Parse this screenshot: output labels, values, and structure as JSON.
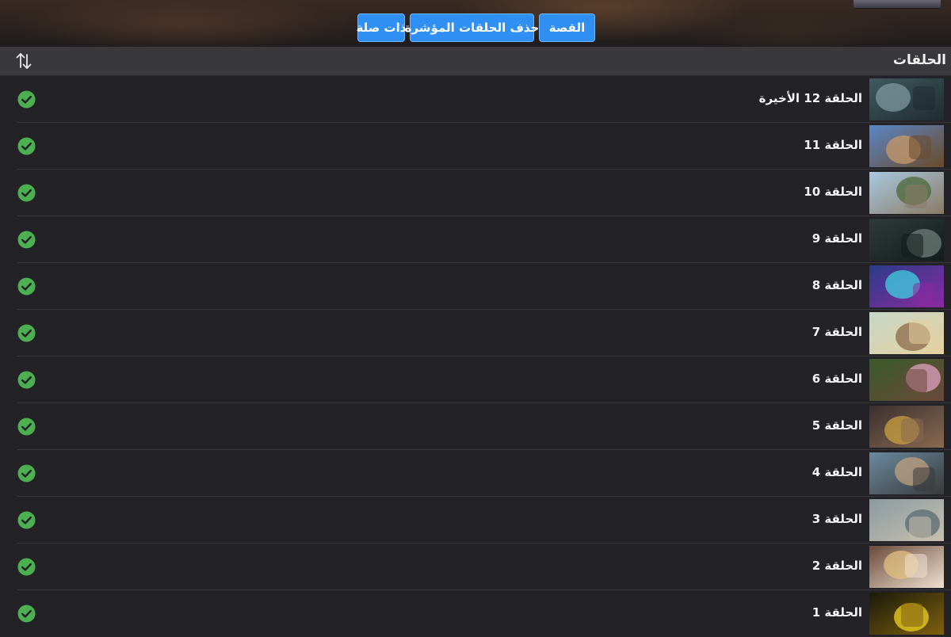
{
  "hero": {
    "buttons": [
      {
        "label": "القصة"
      },
      {
        "label": "حذف الحلقات المؤشرة"
      },
      {
        "label": "ذات صلة"
      }
    ],
    "accent_color": "#2f8ff2"
  },
  "header": {
    "title": "الحلقات",
    "sort_icon": "sort-arrows-icon"
  },
  "episodes": [
    {
      "title": "الحلقة 12 الأخيرة",
      "watched": true
    },
    {
      "title": "الحلقة 11",
      "watched": true
    },
    {
      "title": "الحلقة 10",
      "watched": true
    },
    {
      "title": "الحلقة 9",
      "watched": true
    },
    {
      "title": "الحلقة 8",
      "watched": true
    },
    {
      "title": "الحلقة 7",
      "watched": true
    },
    {
      "title": "الحلقة 6",
      "watched": true
    },
    {
      "title": "الحلقة 5",
      "watched": true
    },
    {
      "title": "الحلقة 4",
      "watched": true
    },
    {
      "title": "الحلقة 3",
      "watched": true
    },
    {
      "title": "الحلقة 2",
      "watched": true
    },
    {
      "title": "الحلقة 1",
      "watched": true
    }
  ],
  "colors": {
    "watched_check": "#4caf50",
    "background": "#232327",
    "header_bar": "#39393b"
  }
}
